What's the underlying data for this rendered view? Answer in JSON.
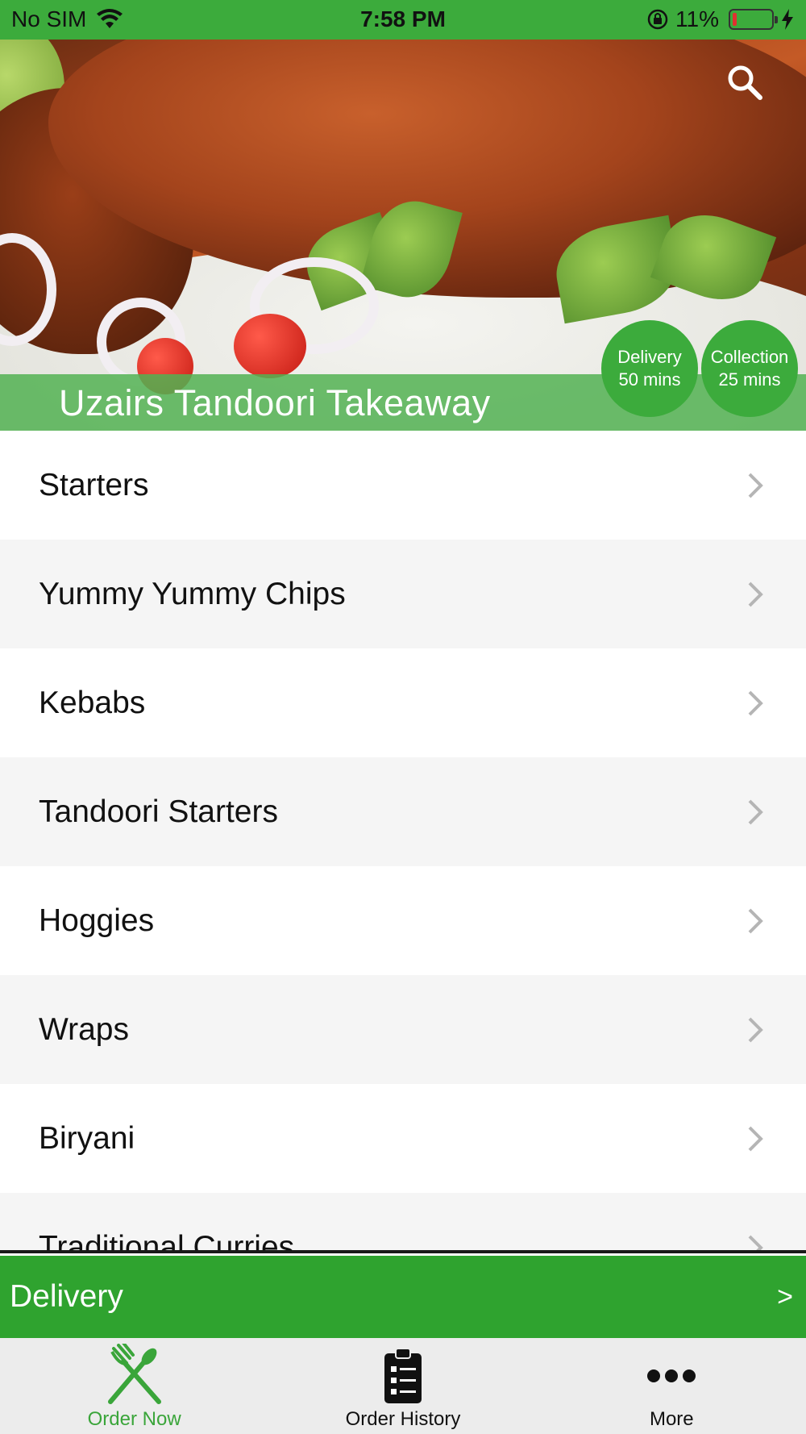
{
  "status_bar": {
    "carrier": "No SIM",
    "time": "7:58 PM",
    "battery": "11%",
    "battery_level": 0.11
  },
  "hero": {
    "restaurant_name": "Uzairs Tandoori Takeaway",
    "delivery_badge": {
      "line1": "Delivery",
      "line2": "50 mins"
    },
    "collection_badge": {
      "line1": "Collection",
      "line2": "25 mins"
    },
    "search_icon": "search-icon"
  },
  "menu": {
    "items": [
      {
        "label": "Starters"
      },
      {
        "label": "Yummy Yummy Chips"
      },
      {
        "label": "Kebabs"
      },
      {
        "label": "Tandoori Starters"
      },
      {
        "label": "Hoggies"
      },
      {
        "label": "Wraps"
      },
      {
        "label": "Biryani"
      },
      {
        "label": "Traditional Curries"
      }
    ]
  },
  "delivery_bar": {
    "label": "Delivery",
    "arrow": ">"
  },
  "tabs": [
    {
      "label": "Order Now",
      "icon": "fork-knife-icon",
      "active": true
    },
    {
      "label": "Order History",
      "icon": "clipboard-list-icon",
      "active": false
    },
    {
      "label": "More",
      "icon": "more-dots-icon",
      "active": false
    }
  ],
  "colors": {
    "brand_green": "#3cab3c",
    "active_tab": "#3aa53a"
  }
}
